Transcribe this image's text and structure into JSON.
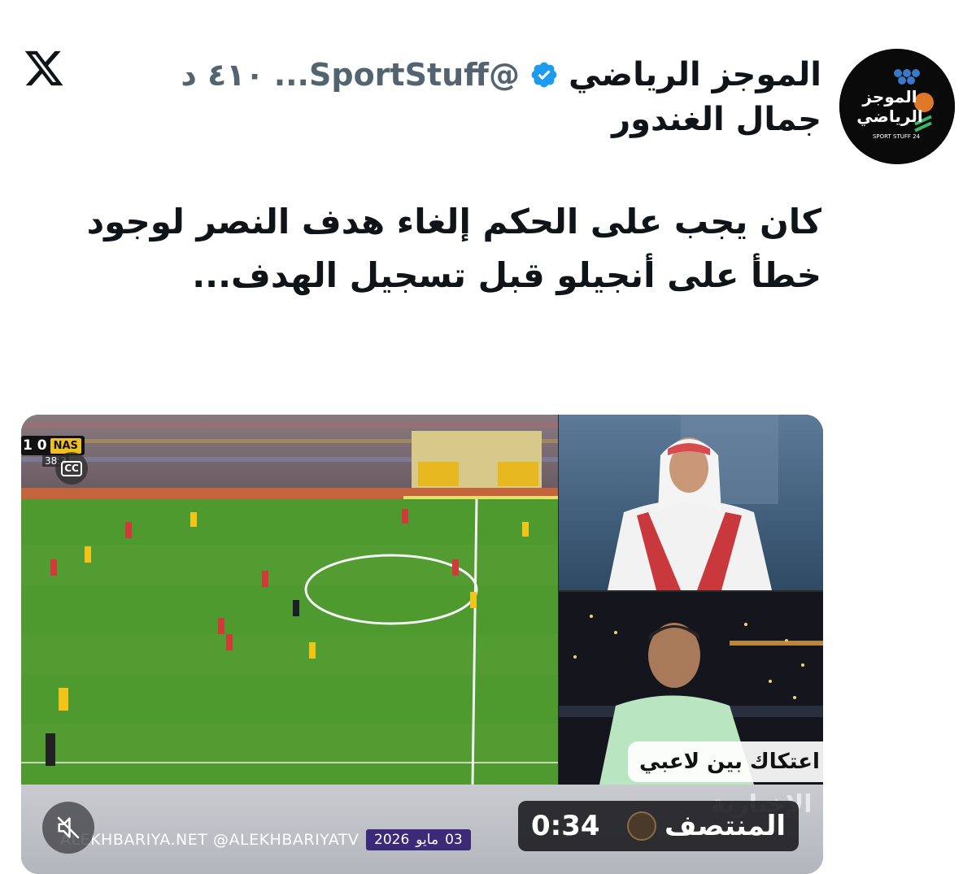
{
  "tweet": {
    "display_name": "الموجز الرياضي",
    "handle": "...SportStuff@",
    "time": "٤١٠ د",
    "sub_name": "جمال الغندور",
    "text": "كان يجب على الحكم إلغاء هدف النصر لوجود خطأ على أنجيلو قبل تسجيل الهدف..."
  },
  "avatar": {
    "line1": "الموجز",
    "line2": "الرياضي",
    "line3": "SPORT STUFF 24"
  },
  "video": {
    "duration": "0:34",
    "channel_name": "المنتصف",
    "ticker": "اعتكاك بين لاعبي",
    "watermark": "الإخبارية",
    "site": "ALEKHBARIYA.NET",
    "tv_handle": "@ALEKHBARIYATV",
    "date_day": "03",
    "date_month": "مايو",
    "date_year": "2026",
    "score": "1  0",
    "team": "NAS",
    "clock": "38:3",
    "cc_label": "CC"
  },
  "colors": {
    "verified": "#1d9bf0",
    "pitch": "#4f9a2e",
    "secondary_text": "#536471"
  },
  "icons": {
    "x_logo": "x-logo-icon",
    "verified": "verified-badge-icon",
    "mute": "speaker-muted-icon",
    "cc": "closed-captions-icon"
  }
}
